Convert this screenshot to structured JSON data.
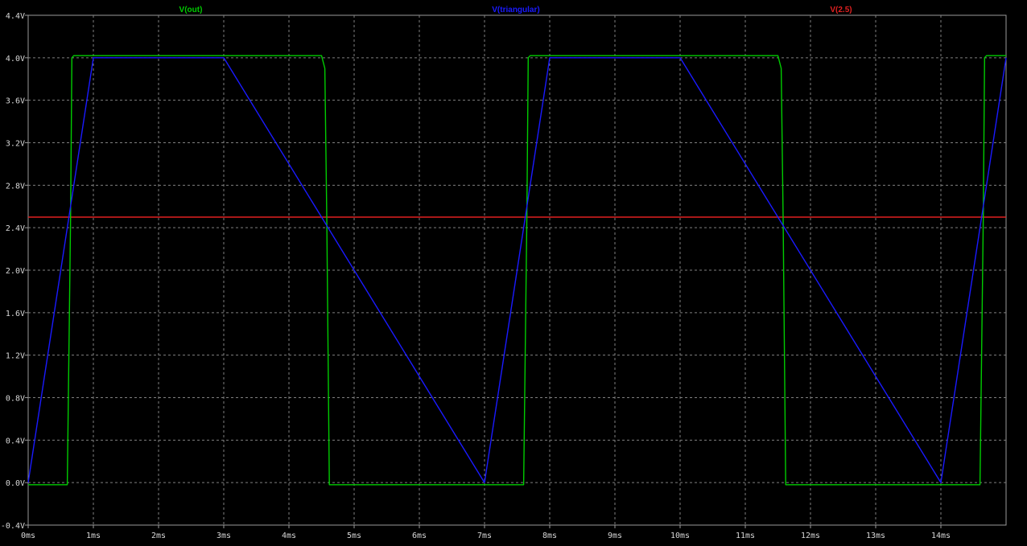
{
  "chart_data": {
    "type": "line",
    "x_unit": "ms",
    "y_unit": "V",
    "xlim": [
      0,
      15
    ],
    "ylim": [
      -0.4,
      4.4
    ],
    "x_ticks": [
      0,
      1,
      2,
      3,
      4,
      5,
      6,
      7,
      8,
      9,
      10,
      11,
      12,
      13,
      14
    ],
    "x_tick_labels": [
      "0ms",
      "1ms",
      "2ms",
      "3ms",
      "4ms",
      "5ms",
      "6ms",
      "7ms",
      "8ms",
      "9ms",
      "10ms",
      "11ms",
      "12ms",
      "13ms",
      "14ms"
    ],
    "y_ticks": [
      -0.4,
      0.0,
      0.4,
      0.8,
      1.2,
      1.6,
      2.0,
      2.4,
      2.8,
      3.2,
      3.6,
      4.0,
      4.4
    ],
    "y_tick_labels": [
      "-0.4V",
      "0.0V",
      "0.4V",
      "0.8V",
      "1.2V",
      "1.6V",
      "2.0V",
      "2.4V",
      "2.8V",
      "3.2V",
      "3.6V",
      "4.0V",
      "4.4V"
    ],
    "grid": true,
    "background_color": "#000000",
    "grid_color": "#808080",
    "series": [
      {
        "name": "V(out)",
        "color": "#00cc00",
        "x": [
          0,
          0.6,
          0.65,
          0.67,
          0.7,
          4.5,
          4.55,
          4.58,
          4.62,
          7.6,
          7.65,
          7.67,
          7.7,
          11.5,
          11.55,
          11.58,
          11.62,
          14.6,
          14.65,
          14.67,
          14.7,
          15
        ],
        "y": [
          -0.02,
          -0.02,
          2.5,
          4.0,
          4.02,
          4.02,
          3.9,
          2.5,
          -0.02,
          -0.02,
          2.5,
          4.0,
          4.02,
          4.02,
          3.9,
          2.5,
          -0.02,
          -0.02,
          2.5,
          4.0,
          4.02,
          4.02
        ]
      },
      {
        "name": "V(triangular)",
        "color": "#1a1aff",
        "x": [
          0,
          1.0,
          3.0,
          7.0,
          8.0,
          10.0,
          14.0,
          15.0
        ],
        "y": [
          0.0,
          4.0,
          4.0,
          0.0,
          4.0,
          4.0,
          0.0,
          4.0
        ]
      },
      {
        "name": "V(2.5)",
        "color": "#e02020",
        "x": [
          0,
          15
        ],
        "y": [
          2.5,
          2.5
        ]
      }
    ]
  }
}
